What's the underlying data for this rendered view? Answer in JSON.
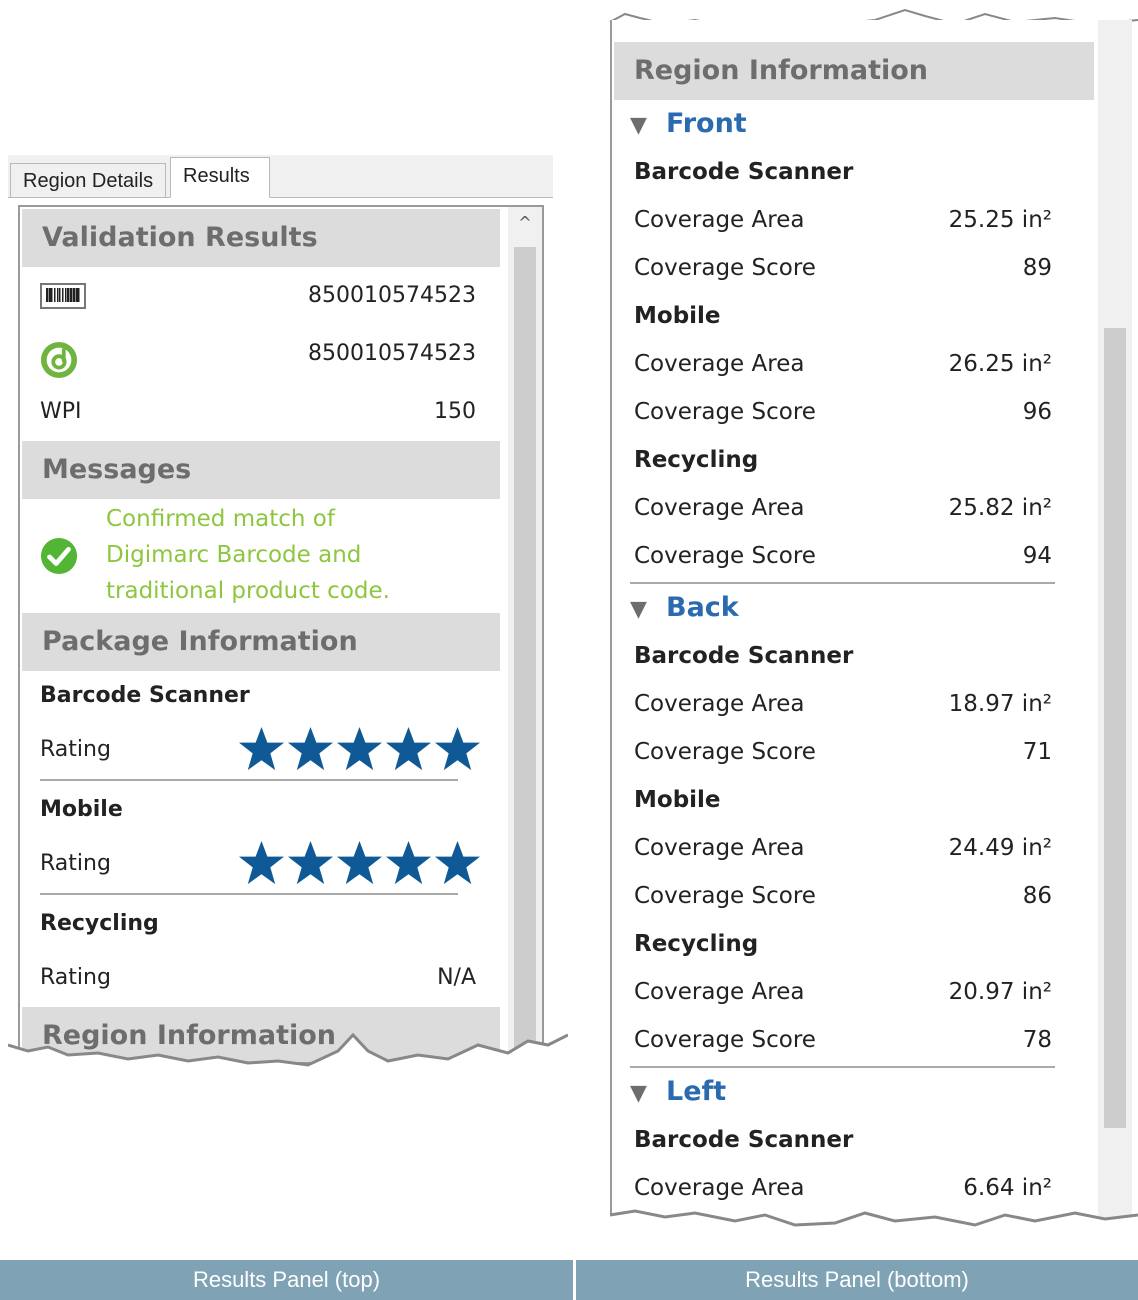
{
  "tabs": [
    "Region Details",
    "Results"
  ],
  "left": {
    "validation": {
      "title": "Validation Results",
      "rows": [
        {
          "icon": "barcode-icon",
          "value": "850010574523"
        },
        {
          "icon": "digimarc-icon",
          "value": "850010574523"
        },
        {
          "label": "WPI",
          "value": "150"
        }
      ]
    },
    "messages": {
      "title": "Messages",
      "text": "Confirmed match of Digimarc Barcode and traditional product code.",
      "color": "#8dc63f"
    },
    "package": {
      "title": "Package Information",
      "groups": [
        {
          "name": "Barcode Scanner",
          "label": "Rating",
          "stars": 5
        },
        {
          "name": "Mobile",
          "label": "Rating",
          "stars": 5
        },
        {
          "name": "Recycling",
          "label": "Rating",
          "value": "N/A"
        }
      ]
    },
    "region_partial": "Region Information"
  },
  "right": {
    "title": "Region Information",
    "faces": [
      {
        "name": "Front",
        "groups": [
          {
            "name": "Barcode Scanner",
            "area_label": "Coverage Area",
            "area": "25.25 in²",
            "score_label": "Coverage Score",
            "score": "89"
          },
          {
            "name": "Mobile",
            "area_label": "Coverage Area",
            "area": "26.25 in²",
            "score_label": "Coverage Score",
            "score": "96"
          },
          {
            "name": "Recycling",
            "area_label": "Coverage Area",
            "area": "25.82 in²",
            "score_label": "Coverage Score",
            "score": "94"
          }
        ]
      },
      {
        "name": "Back",
        "groups": [
          {
            "name": "Barcode Scanner",
            "area_label": "Coverage Area",
            "area": "18.97 in²",
            "score_label": "Coverage Score",
            "score": "71"
          },
          {
            "name": "Mobile",
            "area_label": "Coverage Area",
            "area": "24.49 in²",
            "score_label": "Coverage Score",
            "score": "86"
          },
          {
            "name": "Recycling",
            "area_label": "Coverage Area",
            "area": "20.97 in²",
            "score_label": "Coverage Score",
            "score": "78"
          }
        ]
      },
      {
        "name": "Left",
        "groups": [
          {
            "name": "Barcode Scanner",
            "area_label": "Coverage Area",
            "area": "6.64 in²"
          }
        ]
      }
    ]
  },
  "captions": [
    "Results Panel (top)",
    "Results Panel (bottom)"
  ],
  "colors": {
    "star": "#0f5a96",
    "face_heading": "#2a6bb0",
    "caption_bg": "#7fa3b5"
  }
}
